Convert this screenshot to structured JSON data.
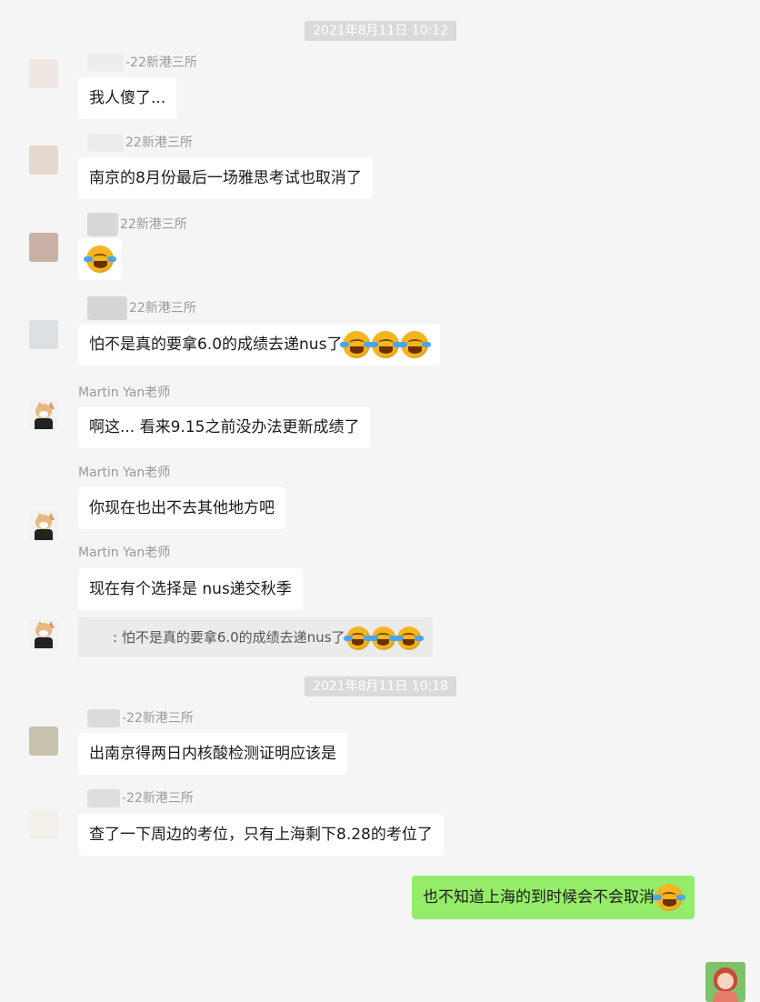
{
  "timestamps": [
    "2021年8月11日 10:12",
    "2021年8月11日 10:18"
  ],
  "messages": [
    {
      "sender": "-22新港三所",
      "text": "我人傻了..."
    },
    {
      "sender": "22新港三所",
      "text": "南京的8月份最后一场雅思考试也取消了"
    },
    {
      "sender": "22新港三所",
      "emoji": "laughing-crying-emoji"
    },
    {
      "sender": "22新港三所",
      "text": "怕不是真的要拿6.0的成绩去递nus了"
    },
    {
      "sender": "Martin Yan老师",
      "text": "啊这... 看来9.15之前没办法更新成绩了"
    },
    {
      "sender": "Martin Yan老师",
      "text": "你现在也出不去其他地方吧"
    },
    {
      "sender": "Martin Yan老师",
      "text": "现在有个选择是 nus递交秋季",
      "quote": ": 怕不是真的要拿6.0的成绩去递nus了"
    },
    {
      "sender": "-22新港三所",
      "text": "出南京得两日内核酸检测证明应该是"
    },
    {
      "sender": "-22新港三所",
      "text": "查了一下周边的考位，只有上海剩下8.28的考位了"
    }
  ],
  "my_message": {
    "text": "也不知道上海的到时候会不会取消"
  },
  "colors": {
    "background": "#f5f5f5",
    "my_bubble": "#95ec69",
    "bubble": "#ffffff",
    "timestamp_bg": "#dadada"
  }
}
